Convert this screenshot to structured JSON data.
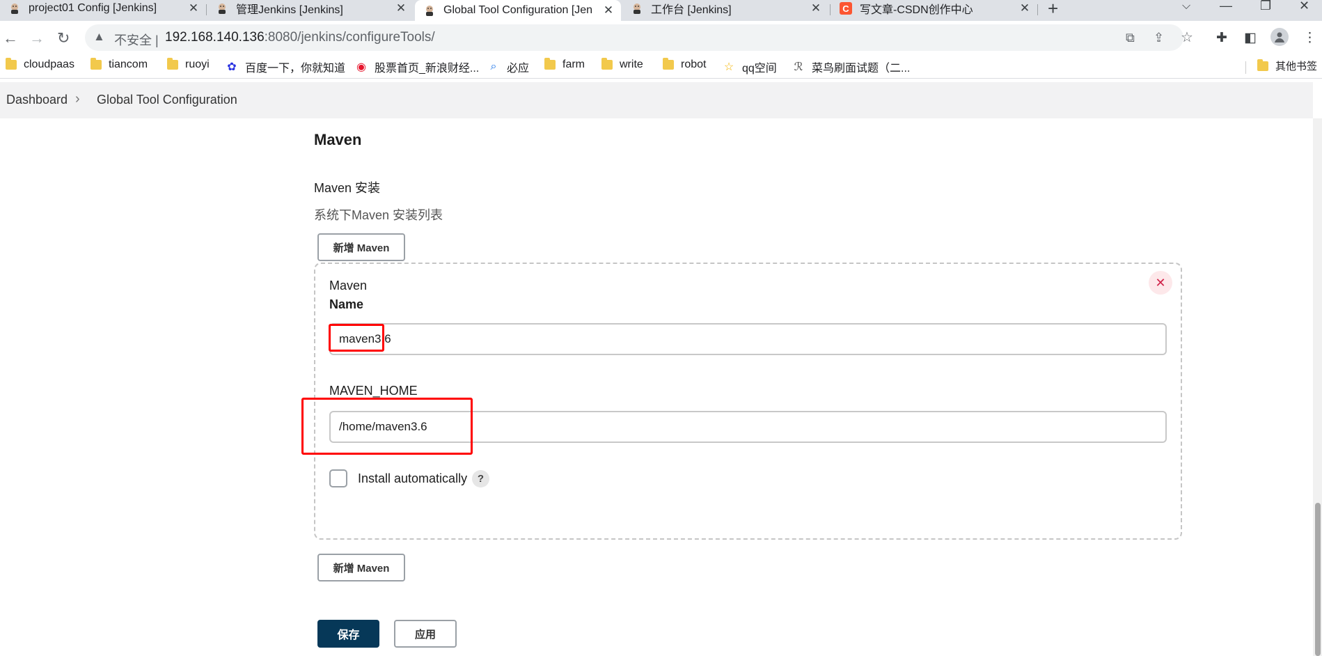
{
  "browser": {
    "tabs": [
      {
        "title": "project01 Config [Jenkins]",
        "icon": "jenkins-icon"
      },
      {
        "title": "管理Jenkins [Jenkins]",
        "icon": "jenkins-icon"
      },
      {
        "title": "Global Tool Configuration [Jen",
        "icon": "jenkins-icon"
      },
      {
        "title": "工作台 [Jenkins]",
        "icon": "jenkins-icon"
      },
      {
        "title": "写文章-CSDN创作中心",
        "icon": "csdn-icon"
      }
    ],
    "url": {
      "insecure_label": "不安全",
      "host": "192.168.140.136",
      "path": ":8080/jenkins/configureTools/"
    },
    "bookmarks": [
      {
        "label": "cloudpaas",
        "icon": "folder-icon"
      },
      {
        "label": "tiancom",
        "icon": "folder-icon"
      },
      {
        "label": "ruoyi",
        "icon": "folder-icon"
      },
      {
        "label": "百度一下，你就知道",
        "icon": "baidu-icon"
      },
      {
        "label": "股票首页_新浪财经...",
        "icon": "weibo-icon"
      },
      {
        "label": "必应",
        "icon": "bing-icon"
      },
      {
        "label": "farm",
        "icon": "folder-icon"
      },
      {
        "label": "write",
        "icon": "folder-icon"
      },
      {
        "label": "robot",
        "icon": "folder-icon"
      },
      {
        "label": "qq空间",
        "icon": "star-icon"
      },
      {
        "label": "菜鸟刷面试题（二...",
        "icon": "runoob-icon"
      }
    ],
    "other_bookmarks": "其他书签"
  },
  "breadcrumb": {
    "items": [
      "Dashboard",
      "Global Tool Configuration"
    ]
  },
  "maven": {
    "section_title": "Maven",
    "installations_label": "Maven 安装",
    "installations_desc": "系统下Maven 安装列表",
    "add_button": "新增 Maven",
    "installation": {
      "type_label": "Maven",
      "name_label": "Name",
      "name_value": "maven3.6",
      "home_label": "MAVEN_HOME",
      "home_value": "/home/maven3.6",
      "install_auto_label": "Install automatically",
      "install_auto_checked": false,
      "help_label": "?"
    }
  },
  "actions": {
    "save": "保存",
    "apply": "应用"
  },
  "colors": {
    "primary": "#063858",
    "annotation": "#ff0000",
    "delete": "#d0244a"
  }
}
